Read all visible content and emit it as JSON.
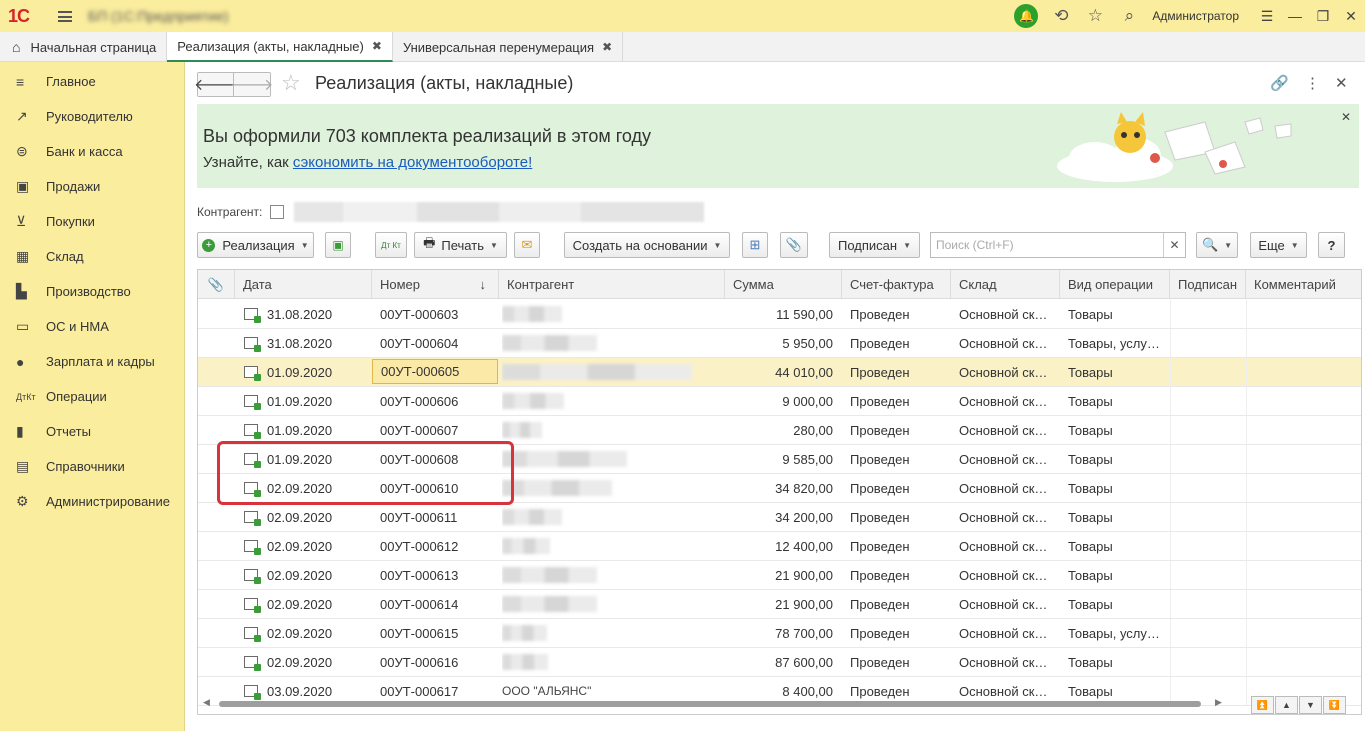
{
  "topbar": {
    "logo": "1С",
    "app_title": "БП (1С:Предприятие)",
    "user": "Администратор"
  },
  "tabs": [
    {
      "label": "Начальная страница"
    },
    {
      "label": "Реализация (акты, накладные)"
    },
    {
      "label": "Универсальная перенумерация"
    }
  ],
  "sidebar": {
    "items": [
      {
        "label": "Главное",
        "icon": "menu-lines-icon"
      },
      {
        "label": "Руководителю",
        "icon": "trend-icon"
      },
      {
        "label": "Банк и касса",
        "icon": "coin-icon"
      },
      {
        "label": "Продажи",
        "icon": "bag-icon"
      },
      {
        "label": "Покупки",
        "icon": "cart-icon"
      },
      {
        "label": "Склад",
        "icon": "warehouse-icon"
      },
      {
        "label": "Производство",
        "icon": "factory-icon"
      },
      {
        "label": "ОС и НМА",
        "icon": "truck-icon"
      },
      {
        "label": "Зарплата и кадры",
        "icon": "person-icon"
      },
      {
        "label": "Операции",
        "icon": "dt-kt-icon"
      },
      {
        "label": "Отчеты",
        "icon": "bar-chart-icon"
      },
      {
        "label": "Справочники",
        "icon": "book-icon"
      },
      {
        "label": "Администрирование",
        "icon": "gear-icon"
      }
    ]
  },
  "page": {
    "title": "Реализация (акты, накладные)"
  },
  "banner": {
    "headline": "Вы оформили 703 комплекта реализаций в этом году",
    "prefix": "Узнайте, как ",
    "link": "сэкономить на документообороте!"
  },
  "filter": {
    "label": "Контрагент:"
  },
  "toolbar": {
    "create": "Реализация",
    "dtkt": "Дт Кт",
    "print": "Печать",
    "create_based": "Создать на основании",
    "signed": "Подписан",
    "search_placeholder": "Поиск (Ctrl+F)",
    "more": "Еще",
    "help": "?"
  },
  "columns": [
    "Дата",
    "Номер",
    "Контрагент",
    "Сумма",
    "Счет-фактура",
    "Склад",
    "Вид операции",
    "Подписан",
    "Комментарий"
  ],
  "sort_indicator": "↓",
  "rows": [
    {
      "date": "31.08.2020",
      "num": "00УТ-000603",
      "sum": "11 590,00",
      "inv": "Проведен",
      "wh": "Основной ск…",
      "op": "Товары"
    },
    {
      "date": "31.08.2020",
      "num": "00УТ-000604",
      "sum": "5 950,00",
      "inv": "Проведен",
      "wh": "Основной ск…",
      "op": "Товары, услу…"
    },
    {
      "date": "01.09.2020",
      "num": "00УТ-000605",
      "sum": "44 010,00",
      "inv": "Проведен",
      "wh": "Основной ск…",
      "op": "Товары"
    },
    {
      "date": "01.09.2020",
      "num": "00УТ-000606",
      "sum": "9 000,00",
      "inv": "Проведен",
      "wh": "Основной ск…",
      "op": "Товары"
    },
    {
      "date": "01.09.2020",
      "num": "00УТ-000607",
      "sum": "280,00",
      "inv": "Проведен",
      "wh": "Основной ск…",
      "op": "Товары"
    },
    {
      "date": "01.09.2020",
      "num": "00УТ-000608",
      "sum": "9 585,00",
      "inv": "Проведен",
      "wh": "Основной ск…",
      "op": "Товары"
    },
    {
      "date": "02.09.2020",
      "num": "00УТ-000610",
      "sum": "34 820,00",
      "inv": "Проведен",
      "wh": "Основной ск…",
      "op": "Товары"
    },
    {
      "date": "02.09.2020",
      "num": "00УТ-000611",
      "sum": "34 200,00",
      "inv": "Проведен",
      "wh": "Основной ск…",
      "op": "Товары"
    },
    {
      "date": "02.09.2020",
      "num": "00УТ-000612",
      "sum": "12 400,00",
      "inv": "Проведен",
      "wh": "Основной ск…",
      "op": "Товары"
    },
    {
      "date": "02.09.2020",
      "num": "00УТ-000613",
      "sum": "21 900,00",
      "inv": "Проведен",
      "wh": "Основной ск…",
      "op": "Товары"
    },
    {
      "date": "02.09.2020",
      "num": "00УТ-000614",
      "sum": "21 900,00",
      "inv": "Проведен",
      "wh": "Основной ск…",
      "op": "Товары"
    },
    {
      "date": "02.09.2020",
      "num": "00УТ-000615",
      "sum": "78 700,00",
      "inv": "Проведен",
      "wh": "Основной ск…",
      "op": "Товары, услу…"
    },
    {
      "date": "02.09.2020",
      "num": "00УТ-000616",
      "sum": "87 600,00",
      "inv": "Проведен",
      "wh": "Основной ск…",
      "op": "Товары"
    },
    {
      "date": "03.09.2020",
      "num": "00УТ-000617",
      "sum": "8 400,00",
      "inv": "Проведен",
      "wh": "Основной ск…",
      "op": "Товары",
      "partner": "ООО \"АЛЬЯНС\""
    }
  ],
  "selected_row": 2,
  "colors": {
    "topbar": "#fbed9e",
    "banner": "#dff2dc",
    "accent": "#2d8b57",
    "highlight": "#d8323c"
  }
}
